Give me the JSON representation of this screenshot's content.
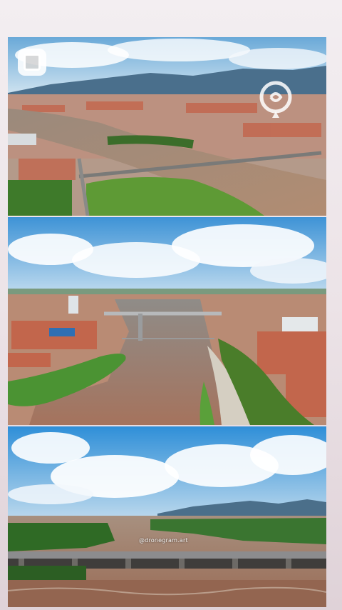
{
  "story": {
    "photos": [
      {
        "name": "aerial-city-river-bridge-1"
      },
      {
        "name": "aerial-river-bridge-green-banks"
      },
      {
        "name": "river-bridge-mountains"
      }
    ],
    "watermark_text": "@dronegram.art",
    "icons": {
      "app_icon": "square-arrow-icon",
      "brand_logo": "location-pin-swirl-logo"
    },
    "colors": {
      "sky": "#5aa6de",
      "river": "#a6816a",
      "vegetation": "#4f8a2d",
      "roofs": "#c8654a"
    }
  }
}
